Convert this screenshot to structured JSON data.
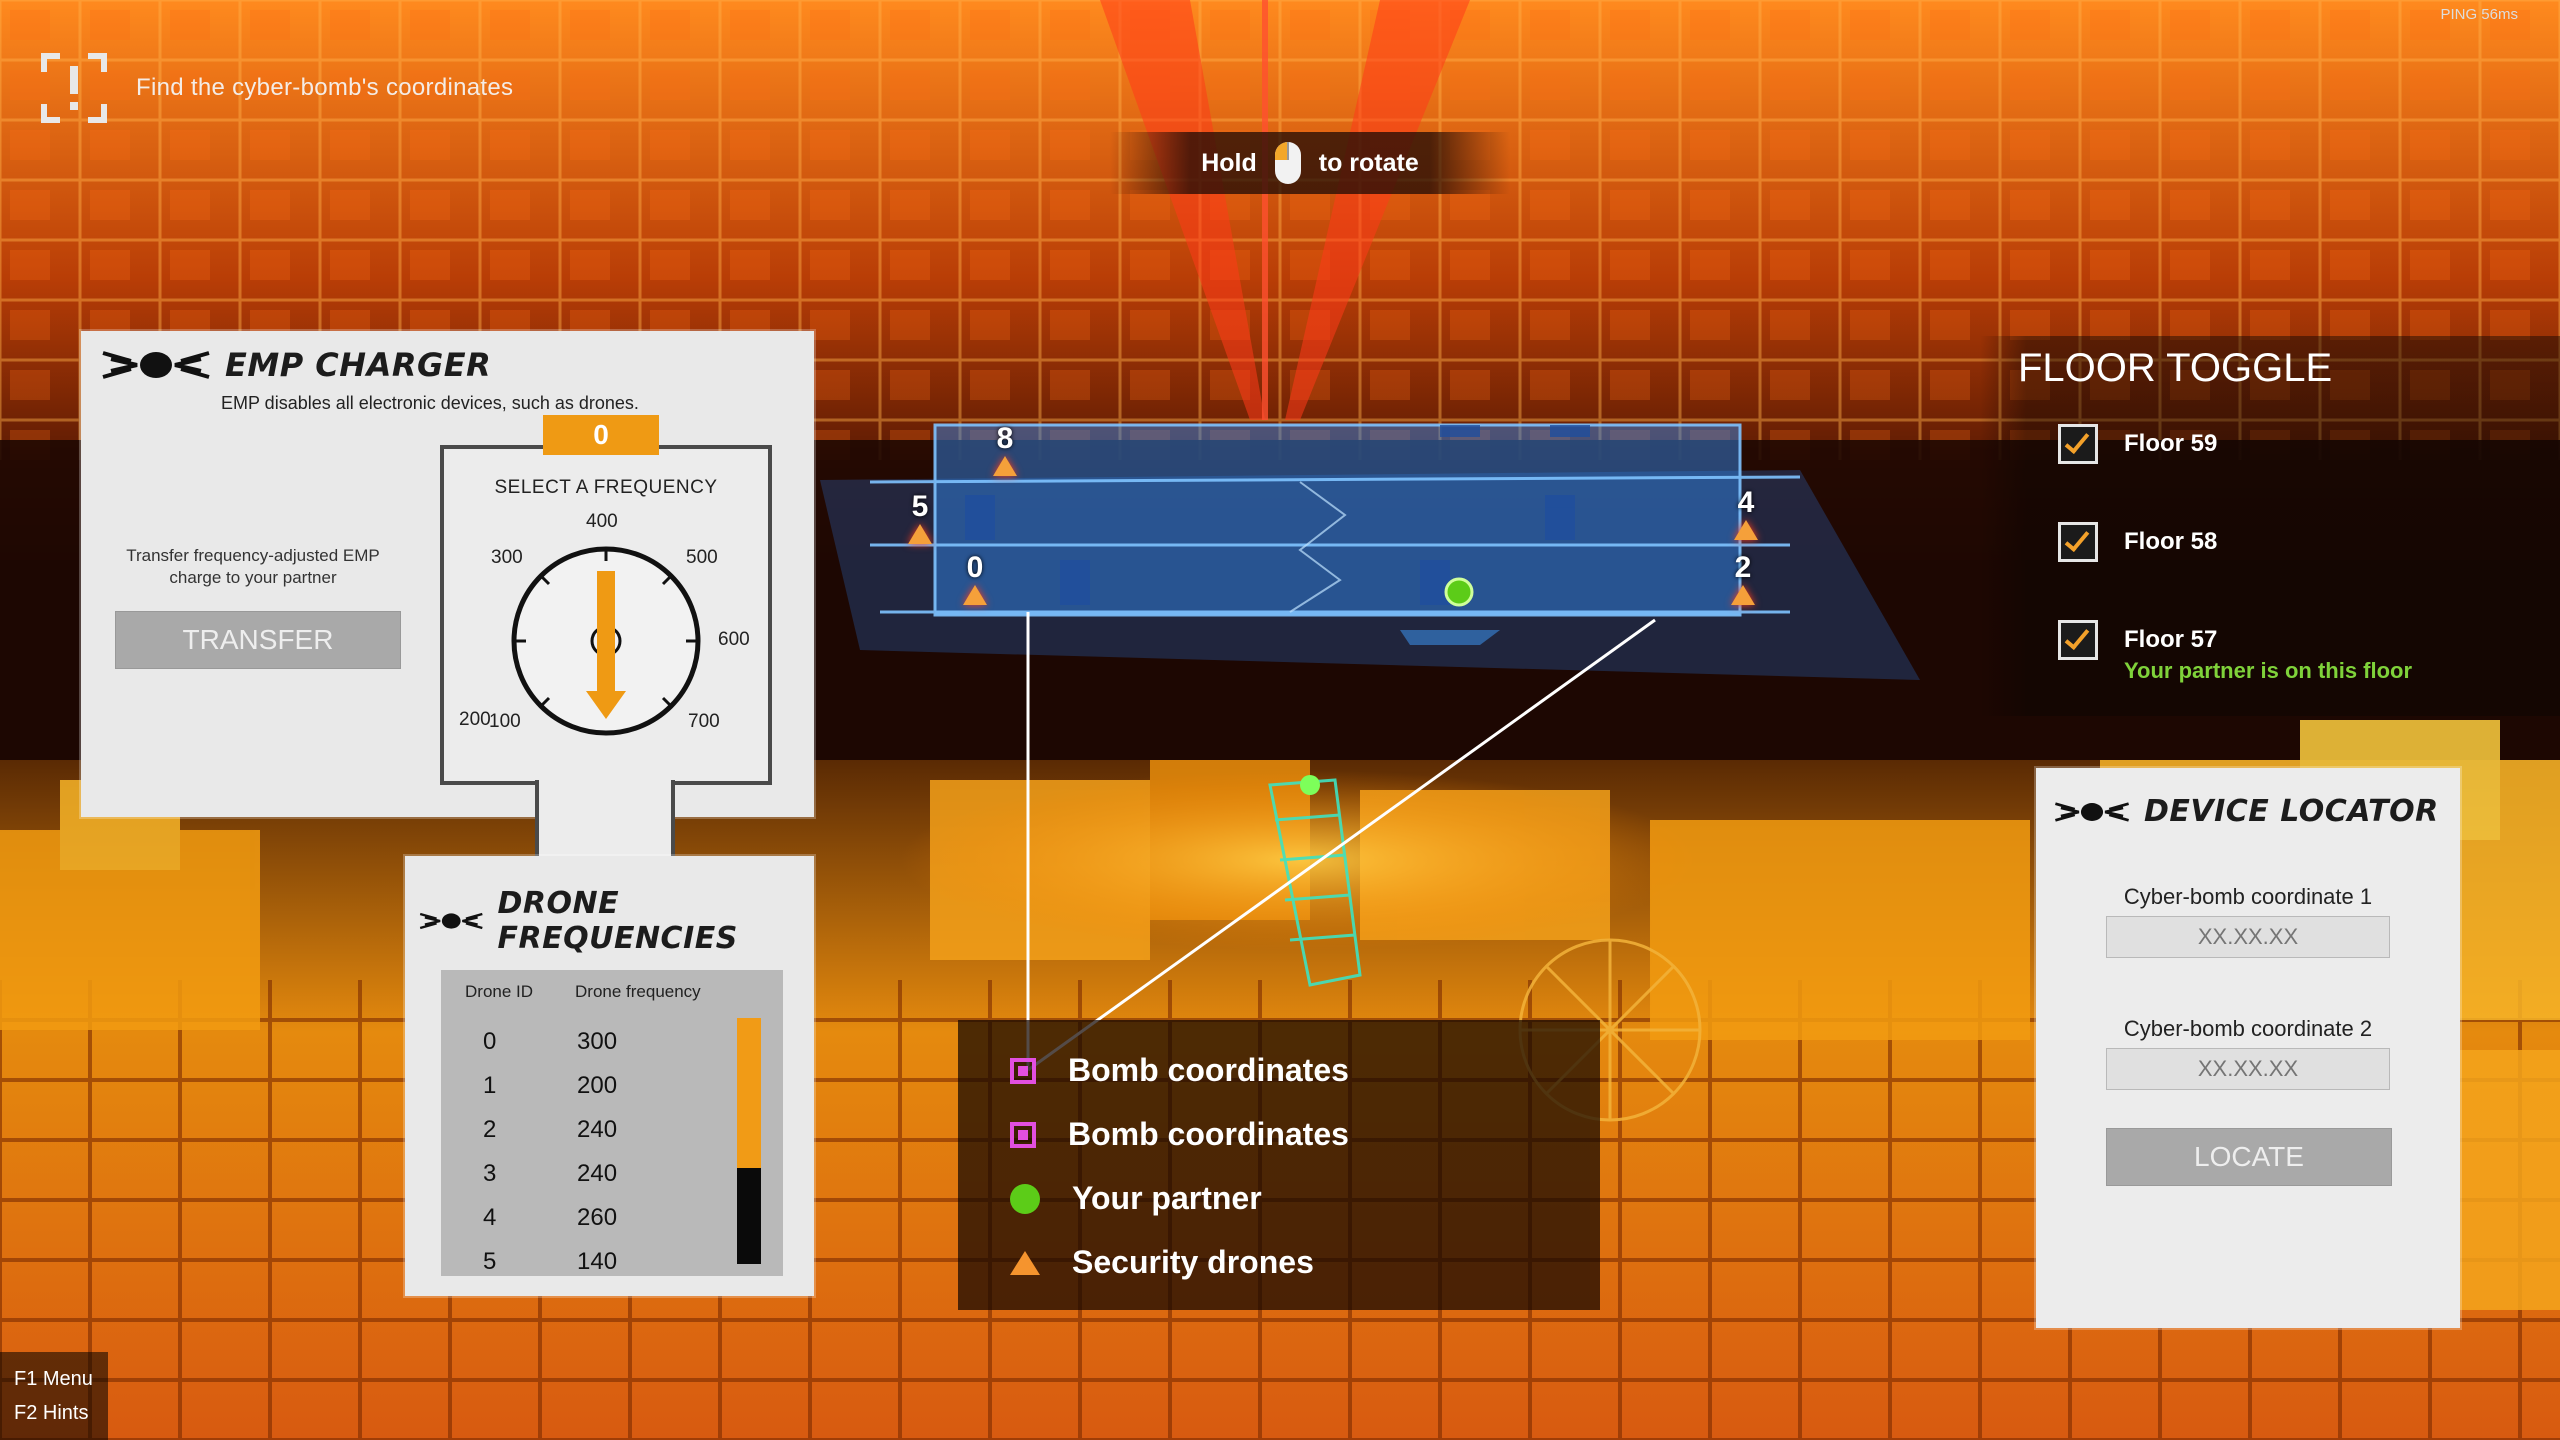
{
  "hud": {
    "objective": "Find the cyber-bomb's coordinates",
    "ping": "PING 56ms",
    "rotate_hint": {
      "before": "Hold",
      "after": "to rotate"
    },
    "hotkeys": [
      "F1 Menu",
      "F2 Hints"
    ]
  },
  "emp_charger": {
    "title": "EMP CHARGER",
    "subtitle": "EMP disables all electronic devices, such as drones.",
    "transfer_note": "Transfer frequency-adjusted EMP charge to your partner",
    "transfer_label": "TRANSFER",
    "select_label": "SELECT A FREQUENCY",
    "dial_labels": [
      "100",
      "200",
      "300",
      "400",
      "500",
      "600",
      "700"
    ],
    "current_frequency": "0"
  },
  "drone_frequencies": {
    "title": "DRONE FREQUENCIES",
    "columns": [
      "Drone ID",
      "Drone frequency"
    ],
    "rows": [
      {
        "id": "0",
        "freq": "300"
      },
      {
        "id": "1",
        "freq": "200"
      },
      {
        "id": "2",
        "freq": "240"
      },
      {
        "id": "3",
        "freq": "240"
      },
      {
        "id": "4",
        "freq": "260"
      },
      {
        "id": "5",
        "freq": "140"
      }
    ]
  },
  "floor_toggle": {
    "title": "FLOOR TOGGLE",
    "floors": [
      {
        "label": "Floor 59",
        "checked": true,
        "note": ""
      },
      {
        "label": "Floor 58",
        "checked": true,
        "note": ""
      },
      {
        "label": "Floor 57",
        "checked": true,
        "note": "Your partner is on this floor"
      }
    ]
  },
  "device_locator": {
    "title": "DEVICE LOCATOR",
    "coord1_label": "Cyber-bomb coordinate 1",
    "coord1_placeholder": "XX.XX.XX",
    "coord2_label": "Cyber-bomb coordinate 2",
    "coord2_placeholder": "XX.XX.XX",
    "locate_label": "LOCATE"
  },
  "legend": {
    "items": [
      {
        "label": "Bomb coordinates",
        "icon": "pink-square-icon"
      },
      {
        "label": "Bomb coordinates",
        "icon": "pink-square-icon"
      },
      {
        "label": "Your partner",
        "icon": "green-dot-icon"
      },
      {
        "label": "Security drones",
        "icon": "orange-triangle-icon"
      }
    ]
  },
  "map_drones": [
    "8",
    "5",
    "4",
    "0",
    "2"
  ],
  "colors": {
    "accent_orange": "#ef9a14",
    "partner_green": "#7fd23a",
    "bomb_pink": "#e24fe0",
    "hologram_blue": "#3a8be0"
  }
}
